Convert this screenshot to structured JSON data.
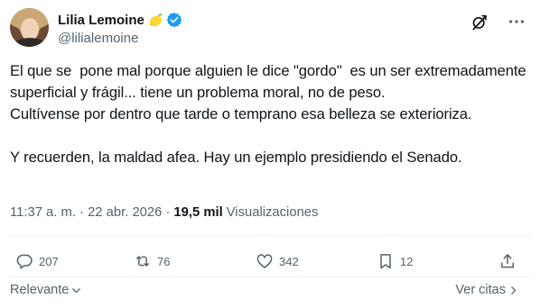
{
  "author": {
    "display_name": "Lilia Lemoine",
    "handle": "@lilialemoine",
    "emoji": "lemon-icon",
    "verified_color": "#1d9bf0"
  },
  "tweet": {
    "text": "El que se  pone mal porque alguien le dice \"gordo\"  es un ser extremadamente superficial y frágil... tiene un problema moral, no de peso.\nCultívense por dentro que tarde o temprano esa belleza se exterioriza.\n\nY recuerden, la maldad afea. Hay un ejemplo presidiendo el Senado.",
    "timestamp": "11:37 a. m. · 22 abr. 2026 ·",
    "views_count": "19,5 mil",
    "views_label": "Visualizaciones"
  },
  "actions": {
    "replies": "207",
    "reposts": "76",
    "likes": "342",
    "bookmarks": "12"
  },
  "replies_bar": {
    "sort_label": "Relevante",
    "quotes_label": "Ver citas"
  },
  "colors": {
    "text": "#0f1419",
    "secondary": "#536471",
    "accent": "#1d9bf0",
    "divider": "#eff3f4"
  }
}
